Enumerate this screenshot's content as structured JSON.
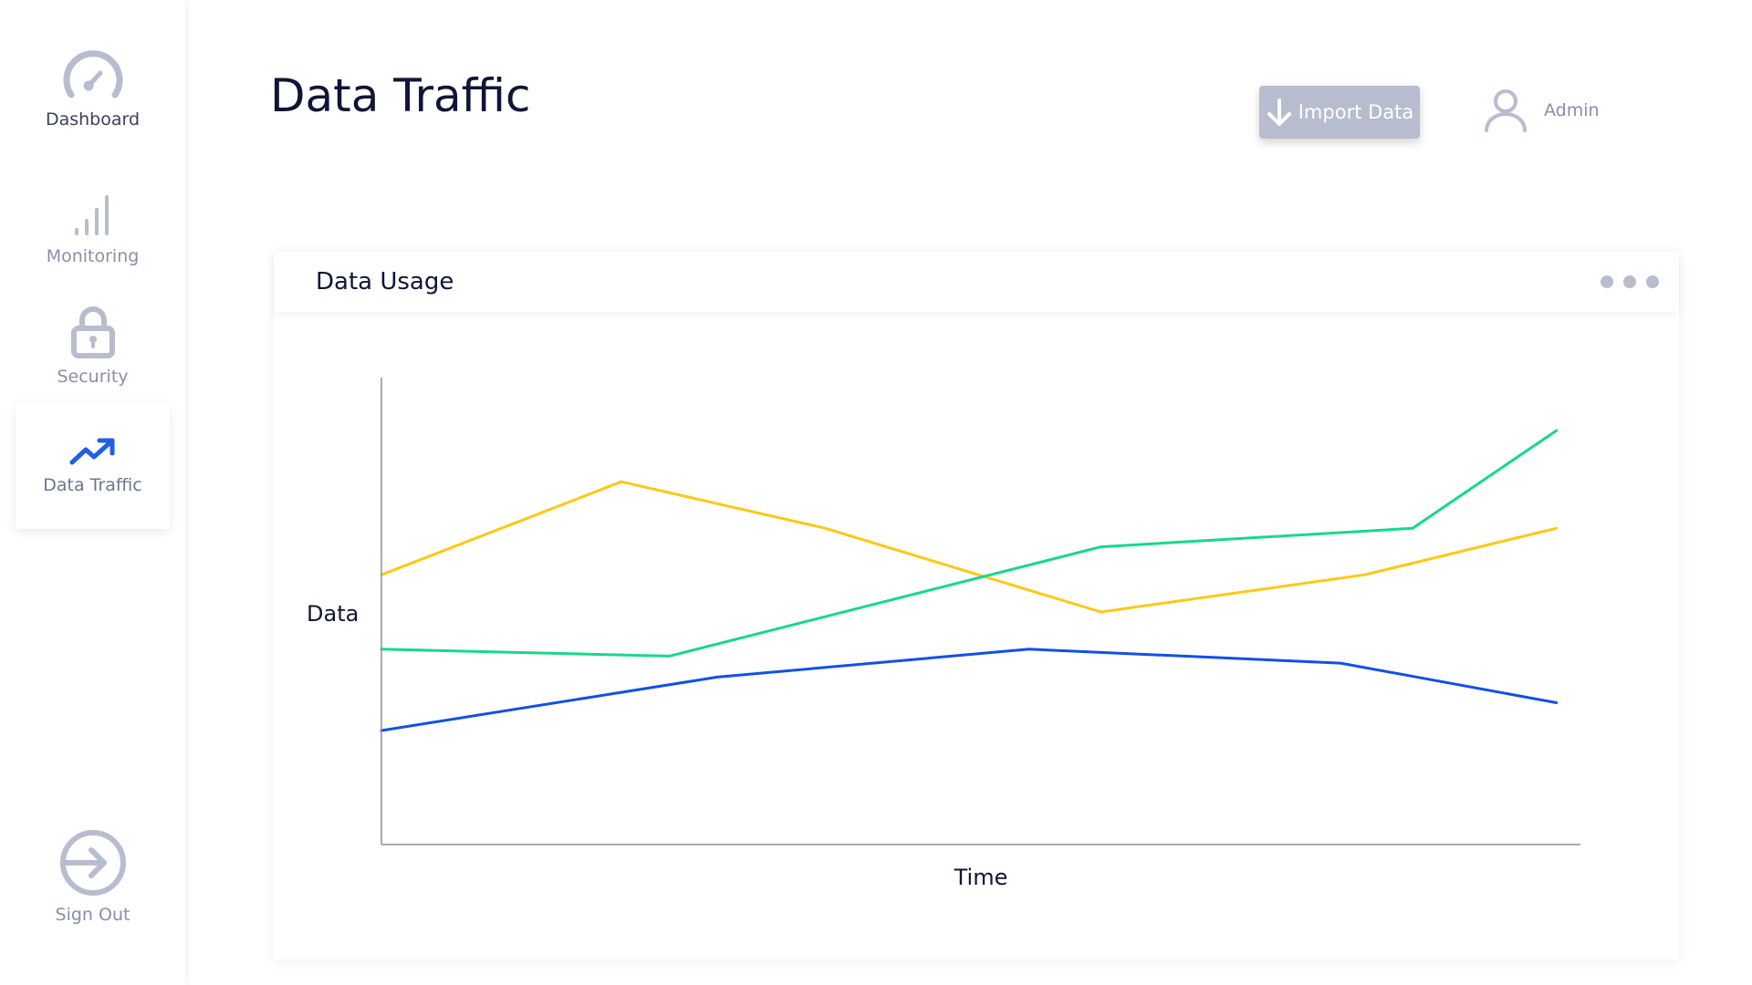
{
  "sidebar": {
    "items": [
      {
        "label": "Dashboard",
        "icon": "gauge-icon"
      },
      {
        "label": "Monitoring",
        "icon": "signal-bars-icon"
      },
      {
        "label": "Security",
        "icon": "lock-icon"
      },
      {
        "label": "Data Traffic",
        "icon": "trending-up-icon",
        "active": true
      }
    ],
    "sign_out": {
      "label": "Sign Out",
      "icon": "sign-in-arrow-icon"
    }
  },
  "header": {
    "title": "Data Traffic",
    "import_button": {
      "label": "Import Data",
      "icon": "arrow-down-icon"
    },
    "user": {
      "name": "Admin",
      "icon": "user-icon"
    }
  },
  "colors": {
    "accent": "#1f5ee6",
    "muted": "#b8bccf",
    "series_blue": "#1150e8",
    "series_green": "#16d98a",
    "series_yellow": "#fcc914"
  },
  "card": {
    "title": "Data Usage",
    "more_icon": "more-horizontal-icon"
  },
  "chart_data": {
    "type": "line",
    "title": "",
    "xlabel": "Time",
    "ylabel": "Data",
    "xlim": [
      0,
      1
    ],
    "ylim": [
      0,
      1
    ],
    "grid": false,
    "legend": "none",
    "series": [
      {
        "color": "#fcc914",
        "points": [
          [
            0,
            0.58
          ],
          [
            0.2,
            0.78
          ],
          [
            0.37,
            0.68
          ],
          [
            0.6,
            0.5
          ],
          [
            0.82,
            0.58
          ],
          [
            0.98,
            0.68
          ]
        ]
      },
      {
        "color": "#16d98a",
        "points": [
          [
            0,
            0.42
          ],
          [
            0.24,
            0.405
          ],
          [
            0.6,
            0.64
          ],
          [
            0.86,
            0.68
          ],
          [
            0.98,
            0.89
          ]
        ]
      },
      {
        "color": "#1150e8",
        "points": [
          [
            0,
            0.245
          ],
          [
            0.28,
            0.36
          ],
          [
            0.54,
            0.42
          ],
          [
            0.8,
            0.39
          ],
          [
            0.98,
            0.305
          ]
        ]
      }
    ]
  }
}
